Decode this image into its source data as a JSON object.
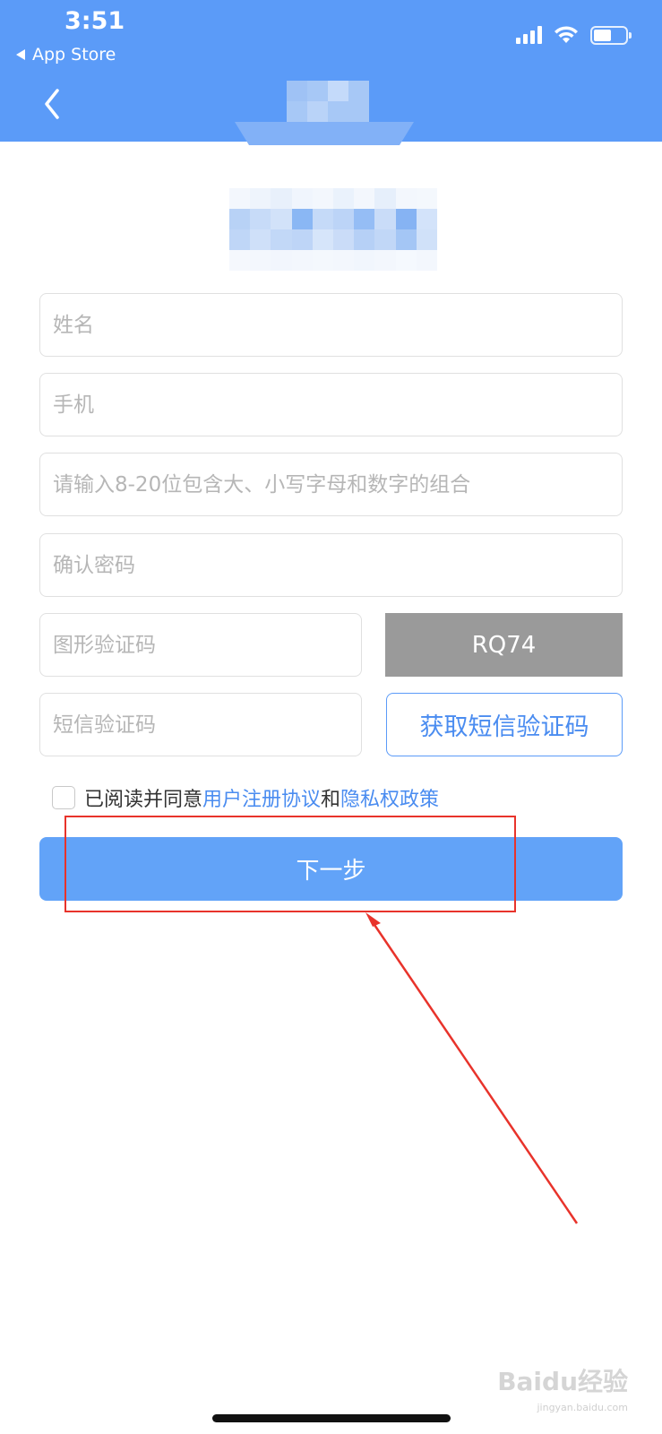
{
  "status_bar": {
    "time": "3:51",
    "back_app": "App Store"
  },
  "form": {
    "name_placeholder": "姓名",
    "phone_placeholder": "手机",
    "password_placeholder": "请输入8-20位包含大、小写字母和数字的组合",
    "confirm_password_placeholder": "确认密码",
    "captcha_placeholder": "图形验证码",
    "captcha_code": "RQ74",
    "sms_placeholder": "短信验证码",
    "sms_button": "获取短信验证码",
    "agree_prefix": "已阅读并同意",
    "user_agreement": "用户注册协议",
    "and": "和",
    "privacy_policy": "隐私权政策",
    "next_button": "下一步"
  },
  "watermark": {
    "brand": "Baidu经验",
    "url": "jingyan.baidu.com"
  },
  "colors": {
    "header": "#5b9bf8",
    "accent": "#4a8cf0",
    "annotation": "#e8332b",
    "captcha_bg": "#9a9a9a"
  }
}
